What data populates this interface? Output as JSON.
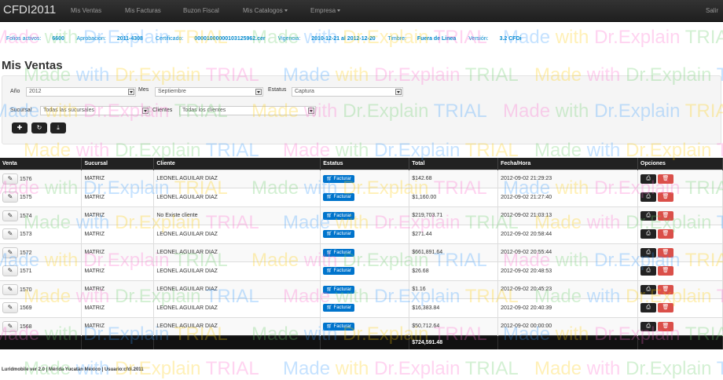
{
  "nav": {
    "brand": "CFDI2011",
    "items": [
      {
        "label": "Mis Ventas",
        "dropdown": false
      },
      {
        "label": "Mis Facturas",
        "dropdown": false
      },
      {
        "label": "Buzon Fiscal",
        "dropdown": false
      },
      {
        "label": "Mis Catalogos",
        "dropdown": true
      },
      {
        "label": "Empresa",
        "dropdown": true
      }
    ],
    "salir": "Salir"
  },
  "info": {
    "folios_label": "Folios activos:",
    "folios_value": "6600",
    "aprobacion_label": "Aprobacion:",
    "aprobacion_value": "2011-4308",
    "certificado_label": "Certificado:",
    "certificado_value": "00001000000103125962.cer",
    "vigencia_label": "Vigencia:",
    "vigencia_value": "2010-12-21 al 2012-12-20",
    "timbre_label": "Timbre:",
    "timbre_value": "Fuera de Linea",
    "version_label": "Versión:",
    "version_value": "3.2 CFDi"
  },
  "page_title": "Mis Ventas",
  "filters": {
    "anio_label": "Año",
    "anio_value": "2012",
    "mes_label": "Mes",
    "mes_value": "Septiembre",
    "estatus_label": "Estatus",
    "estatus_value": "Captura",
    "sucursal_label": "Sucursal",
    "sucursal_value": "Todas las sucursales",
    "clientes_label": "Clientes",
    "clientes_value": "Todas los clientes"
  },
  "toolbar": {
    "add_icon": "plus-icon",
    "refresh_icon": "refresh-icon",
    "download_icon": "download-icon"
  },
  "table": {
    "headers": [
      "Venta",
      "Sucursal",
      "Cliente",
      "Estatus",
      "Total",
      "Fecha/Hora",
      "Opciones"
    ],
    "facturar_label": "Facturar",
    "rows": [
      {
        "venta": "1576",
        "sucursal": "MATRIZ",
        "cliente": "LEONEL AGUILAR DIAZ",
        "total": "$142.68",
        "fecha": "2012-09-02 21:29:23"
      },
      {
        "venta": "1575",
        "sucursal": "MATRIZ",
        "cliente": "LEONEL AGUILAR DIAZ",
        "total": "$1,160.00",
        "fecha": "2012-09-02 21:27:40"
      },
      {
        "venta": "1574",
        "sucursal": "MATRIZ",
        "cliente": "No Existe cliente",
        "total": "$219,703.71",
        "fecha": "2012-09-02 21:03:13"
      },
      {
        "venta": "1573",
        "sucursal": "MATRIZ",
        "cliente": "LEONEL AGUILAR DIAZ",
        "total": "$271.44",
        "fecha": "2012-09-02 20:58:44"
      },
      {
        "venta": "1572",
        "sucursal": "MATRIZ",
        "cliente": "LEONEL AGUILAR DIAZ",
        "total": "$661,891.64",
        "fecha": "2012-09-02 20:55:44"
      },
      {
        "venta": "1571",
        "sucursal": "MATRIZ",
        "cliente": "LEONEL AGUILAR DIAZ",
        "total": "$26.68",
        "fecha": "2012-09-02 20:48:53"
      },
      {
        "venta": "1570",
        "sucursal": "MATRIZ",
        "cliente": "LEONEL AGUILAR DIAZ",
        "total": "$1.16",
        "fecha": "2012-09-02 20:45:23"
      },
      {
        "venta": "1569",
        "sucursal": "MATRIZ",
        "cliente": "LEONEL AGUILAR DIAZ",
        "total": "$16,383.84",
        "fecha": "2012-09-02 20:40:39"
      },
      {
        "venta": "1568",
        "sucursal": "MATRIZ",
        "cliente": "LEONEL AGUILAR DIAZ",
        "total": "$50,712.64",
        "fecha": "2012-09-02 00:00:00"
      }
    ],
    "grand_total": "$724,591.48"
  },
  "footer": "Luridmobile ver 2.0 | Mérida Yucatán México | Usuario:cfdi.2011",
  "watermark": {
    "text_a": "Made",
    "text_b": "with",
    "text_c": "Dr.Explain",
    "text_d": "TRIAL"
  },
  "colors": {
    "accent": "#0088cc",
    "facturar": "#0074cc",
    "delete": "#da4f49",
    "navbar": "#222222"
  }
}
